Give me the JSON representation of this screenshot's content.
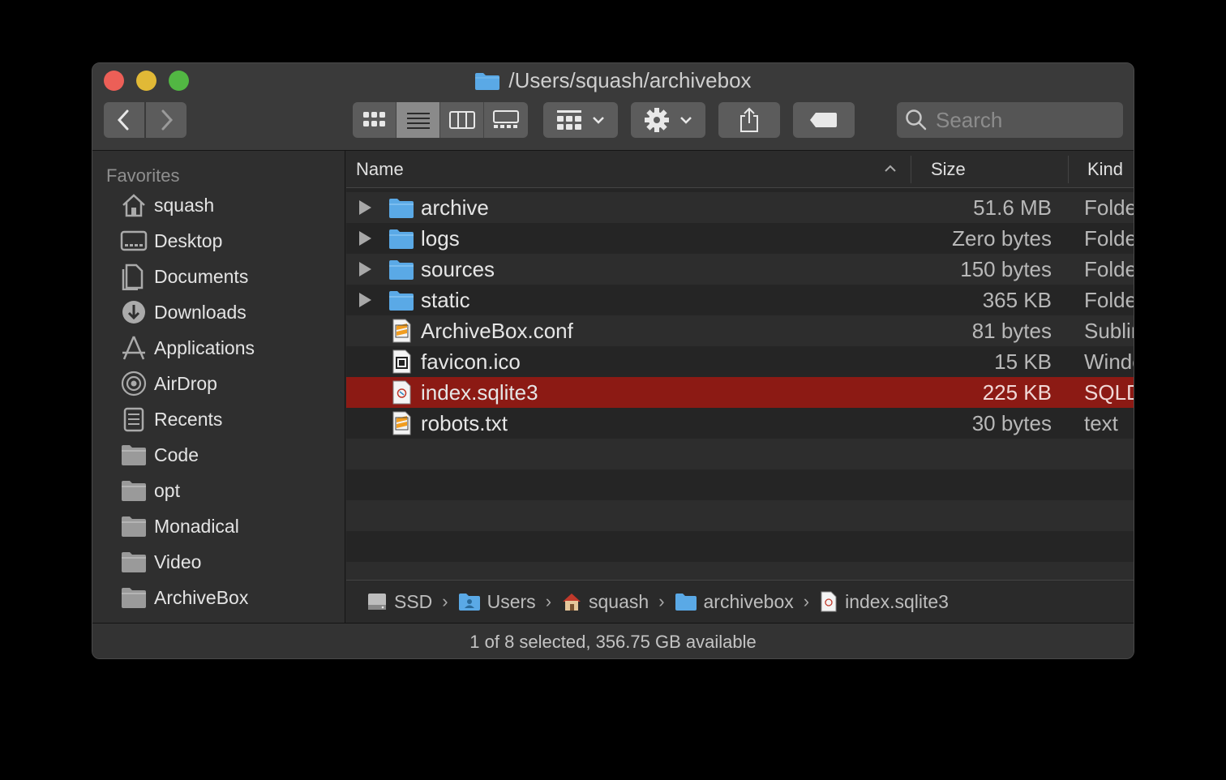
{
  "window": {
    "title": "/Users/squash/archivebox"
  },
  "toolbar": {
    "back_icon": "chevron-left-icon",
    "forward_icon": "chevron-right-icon",
    "view_modes": [
      "icon-view",
      "list-view",
      "column-view",
      "gallery-view"
    ],
    "active_view": "list-view",
    "group_icon": "group-by-icon",
    "action_icon": "gear-icon",
    "share_icon": "share-icon",
    "tag_icon": "tag-icon",
    "search_placeholder": "Search"
  },
  "sidebar": {
    "heading": "Favorites",
    "items": [
      {
        "label": "squash",
        "icon": "home-icon"
      },
      {
        "label": "Desktop",
        "icon": "desktop-icon"
      },
      {
        "label": "Documents",
        "icon": "documents-icon"
      },
      {
        "label": "Downloads",
        "icon": "downloads-icon"
      },
      {
        "label": "Applications",
        "icon": "applications-icon"
      },
      {
        "label": "AirDrop",
        "icon": "airdrop-icon"
      },
      {
        "label": "Recents",
        "icon": "recents-icon"
      },
      {
        "label": "Code",
        "icon": "folder-icon"
      },
      {
        "label": "opt",
        "icon": "folder-icon"
      },
      {
        "label": "Monadical",
        "icon": "folder-icon"
      },
      {
        "label": "Video",
        "icon": "folder-icon"
      },
      {
        "label": "ArchiveBox",
        "icon": "folder-icon"
      }
    ]
  },
  "columns": {
    "name": "Name",
    "size": "Size",
    "kind": "Kind"
  },
  "files": [
    {
      "name": "archive",
      "size": "51.6 MB",
      "kind": "Folder",
      "type": "folder",
      "expandable": true,
      "selected": false
    },
    {
      "name": "logs",
      "size": "Zero bytes",
      "kind": "Folder",
      "type": "folder",
      "expandable": true,
      "selected": false
    },
    {
      "name": "sources",
      "size": "150 bytes",
      "kind": "Folder",
      "type": "folder",
      "expandable": true,
      "selected": false
    },
    {
      "name": "static",
      "size": "365 KB",
      "kind": "Folder",
      "type": "folder",
      "expandable": true,
      "selected": false
    },
    {
      "name": "ArchiveBox.conf",
      "size": "81 bytes",
      "kind": "Sublime",
      "type": "sublime-doc",
      "expandable": false,
      "selected": false
    },
    {
      "name": "favicon.ico",
      "size": "15 KB",
      "kind": "Windows",
      "type": "ico-doc",
      "expandable": false,
      "selected": false
    },
    {
      "name": "index.sqlite3",
      "size": "225 KB",
      "kind": "SQLD",
      "type": "sqlite-doc",
      "expandable": false,
      "selected": true
    },
    {
      "name": "robots.txt",
      "size": "30 bytes",
      "kind": "text",
      "type": "sublime-doc",
      "expandable": false,
      "selected": false
    }
  ],
  "pathbar": [
    {
      "label": "SSD",
      "icon": "drive-icon"
    },
    {
      "label": "Users",
      "icon": "users-folder-icon"
    },
    {
      "label": "squash",
      "icon": "home-icon"
    },
    {
      "label": "archivebox",
      "icon": "folder-icon"
    },
    {
      "label": "index.sqlite3",
      "icon": "sqlite-doc-icon"
    }
  ],
  "status": "1 of 8 selected, 356.75 GB available",
  "colors": {
    "selection": "#8c1a14",
    "folder": "#5aa9e6",
    "close": "#ec5f57",
    "minimize": "#e1b936",
    "maximize": "#52b743"
  }
}
